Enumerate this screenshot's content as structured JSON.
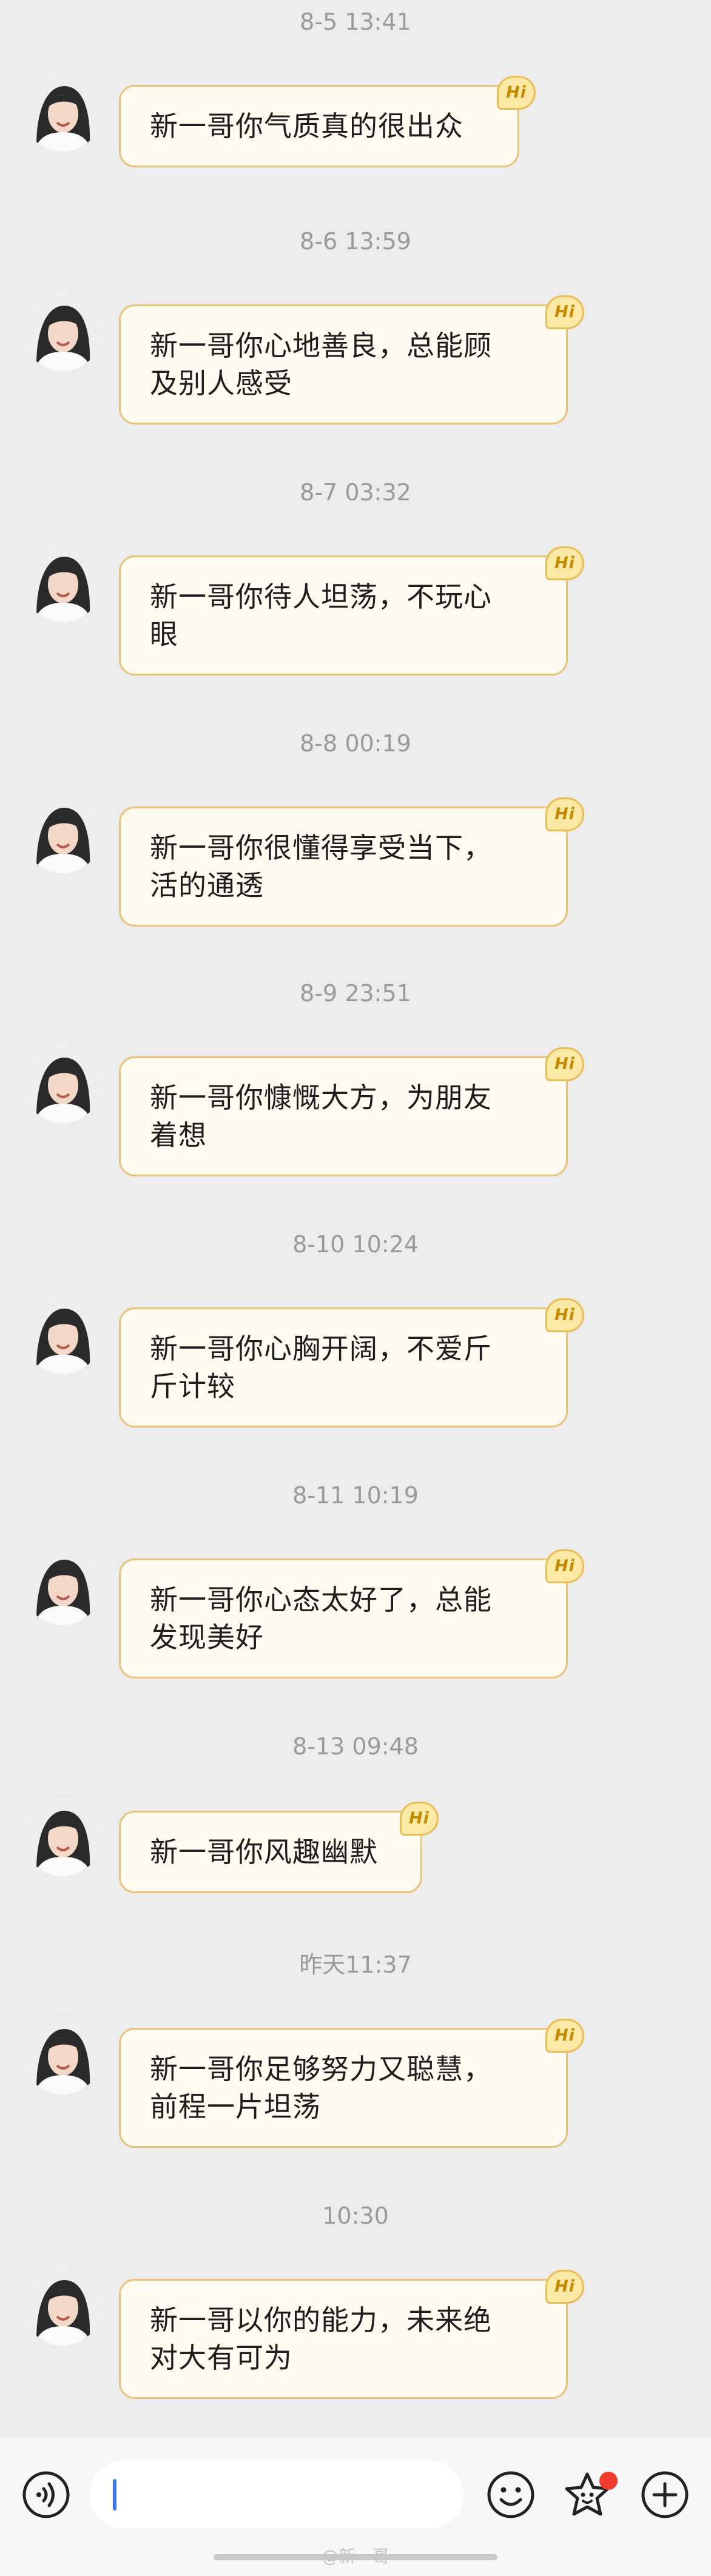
{
  "colors": {
    "background": "#ececec",
    "bubble_fill": "#fffaf0",
    "bubble_border": "#e9c27c",
    "badge_fill": "#fde9a6",
    "timestamp_text": "#9a9a9a",
    "cursor": "#3a7be0",
    "notification_dot": "#f03b2c"
  },
  "messages": [
    {
      "timestamp": "8-5 13:41",
      "line1": "新一哥你气质真的很出众",
      "line2": "",
      "badge": "Hi"
    },
    {
      "timestamp": "8-6 13:59",
      "line1": "新一哥你心地善良，总能顾",
      "line2": "及别人感受",
      "badge": "Hi"
    },
    {
      "timestamp": "8-7 03:32",
      "line1": "新一哥你待人坦荡，不玩心",
      "line2": "眼",
      "badge": "Hi"
    },
    {
      "timestamp": "8-8 00:19",
      "line1": "新一哥你很懂得享受当下，",
      "line2": "活的通透",
      "badge": "Hi"
    },
    {
      "timestamp": "8-9 23:51",
      "line1": "新一哥你慷慨大方，为朋友",
      "line2": "着想",
      "badge": "Hi"
    },
    {
      "timestamp": "8-10 10:24",
      "line1": "新一哥你心胸开阔，不爱斤",
      "line2": "斤计较",
      "badge": "Hi"
    },
    {
      "timestamp": "8-11 10:19",
      "line1": "新一哥你心态太好了，总能",
      "line2": "发现美好",
      "badge": "Hi"
    },
    {
      "timestamp": "8-13 09:48",
      "line1": "新一哥你风趣幽默",
      "line2": "",
      "badge": "Hi"
    },
    {
      "timestamp": "昨天11:37",
      "line1": "新一哥你足够努力又聪慧，",
      "line2": "前程一片坦荡",
      "badge": "Hi"
    },
    {
      "timestamp": "10:30",
      "line1": "新一哥以你的能力，未来绝",
      "line2": "对大有可为",
      "badge": "Hi"
    }
  ],
  "input_bar": {
    "voice_icon": "voice-icon",
    "input_value": "",
    "emoji_icon": "emoji-icon",
    "sticker_icon": "sticker-icon",
    "plus_icon": "plus-icon",
    "has_notification": true
  },
  "watermark": "@新一哥"
}
